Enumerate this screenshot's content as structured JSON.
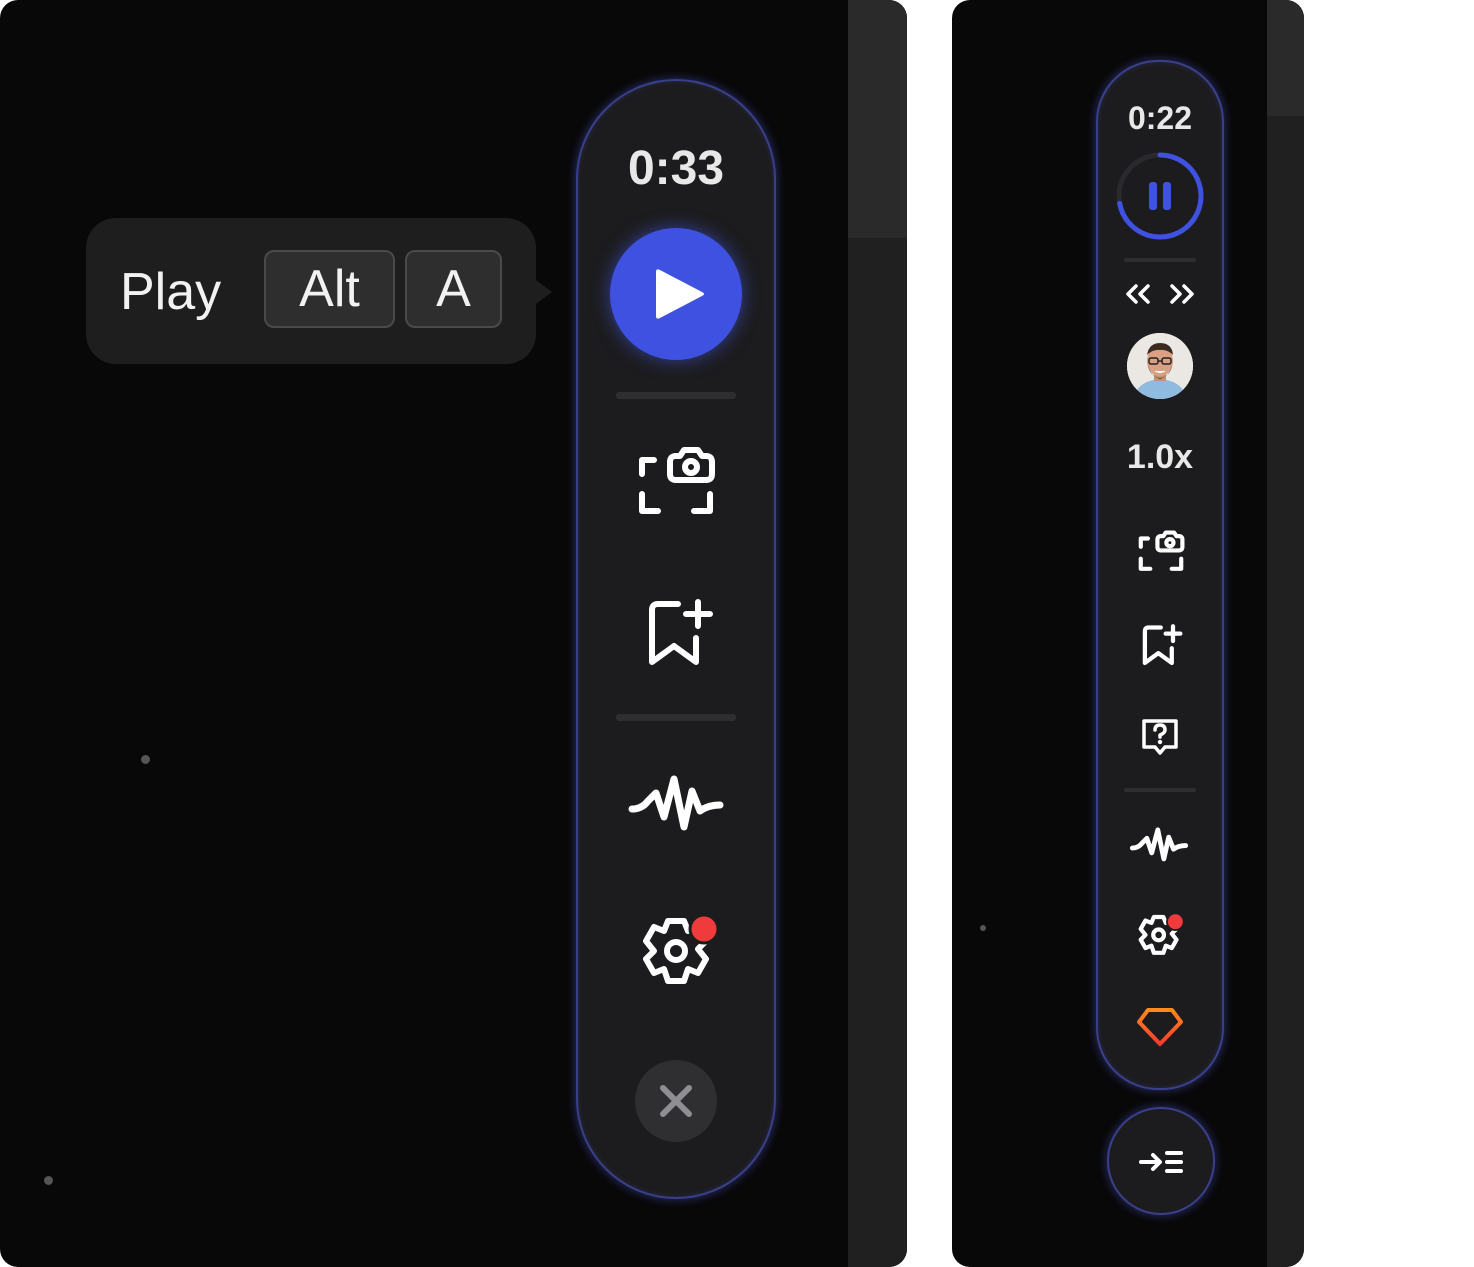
{
  "left_widget": {
    "timer": "0:33",
    "tooltip": {
      "label": "Play",
      "keys": [
        "Alt",
        "A"
      ]
    }
  },
  "right_widget": {
    "timer": "0:22",
    "progress": 0.72,
    "playback_speed": "1.0x"
  },
  "colors": {
    "accent": "#3f51e0",
    "pill_border": "#3a3f8a",
    "notification": "#ef3b3b",
    "premium_gradient": [
      "#ff8a1e",
      "#ff3b2e"
    ]
  }
}
